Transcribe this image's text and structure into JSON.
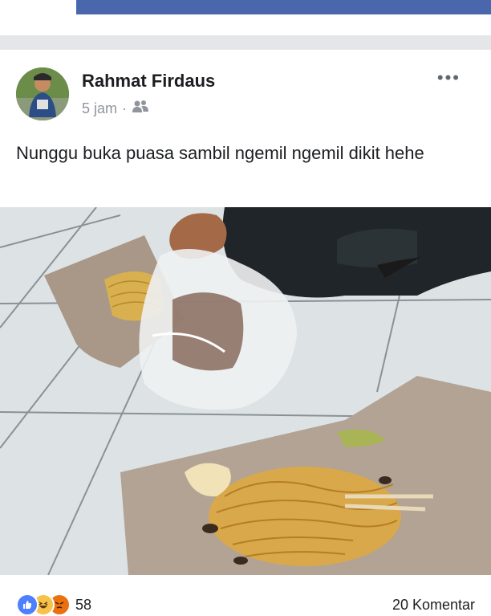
{
  "post": {
    "author": "Rahmat Firdaus",
    "time": "5 jam",
    "separator": "·",
    "caption": "Nunggu buka puasa sambil ngemil ngemil dikit hehe",
    "more_icon": "•••"
  },
  "footer": {
    "reaction_count": "58",
    "comments": "20 Komentar"
  },
  "colors": {
    "header_blue": "#4a67ad",
    "like_blue": "#4d7fff",
    "haha_yellow": "#f7c24a",
    "angry_orange": "#e9710f"
  },
  "icons": [
    "friends-audience-icon",
    "more-options-icon",
    "like-reaction-icon",
    "haha-reaction-icon",
    "angry-reaction-icon"
  ]
}
